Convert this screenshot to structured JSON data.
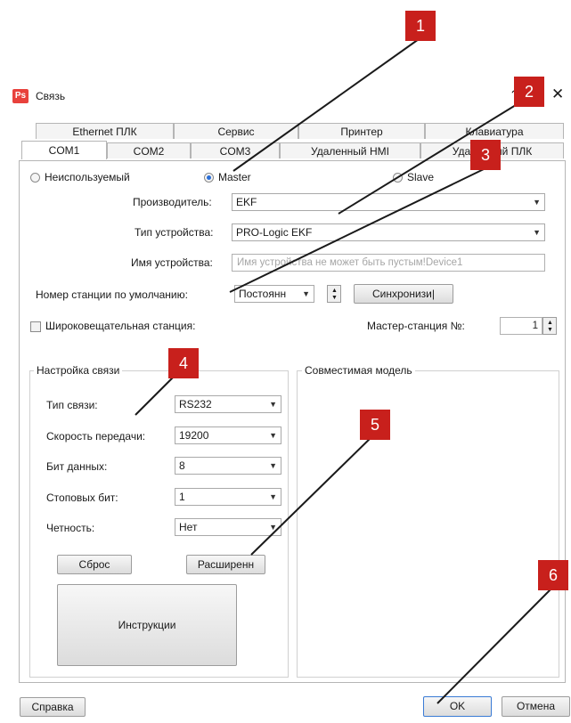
{
  "window": {
    "title": "Связь",
    "app_icon": "Ps",
    "help": "?",
    "close": "✕"
  },
  "tabs_row1": [
    "Ethernet ПЛК",
    "Сервис",
    "Принтер",
    "Клавиатура"
  ],
  "tabs_row2": [
    "COM1",
    "COM2",
    "COM3",
    "Удаленный HMI",
    "Удаленный ПЛК"
  ],
  "mode": {
    "unused": "Неиспользуемый",
    "master": "Master",
    "slave": "Slave"
  },
  "form": {
    "manufacturer_label": "Производитель:",
    "manufacturer_value": "EKF",
    "device_type_label": "Тип устройства:",
    "device_type_value": "PRO-Logic EKF",
    "device_name_label": "Имя устройства:",
    "device_name_placeholder": "Имя устройства не может быть пустым!Device1",
    "station_label": "Номер станции по умолчанию:",
    "station_value": "Постоянн",
    "sync_button": "Синхронизи|",
    "broadcast_label": "Широковещательная станция:",
    "master_station_label": "Мастер-станция №:",
    "master_station_value": "1"
  },
  "comm": {
    "group_title": "Настройка связи",
    "type_label": "Тип связи:",
    "type_value": "RS232",
    "baud_label": "Скорость передачи:",
    "baud_value": "19200",
    "data_bits_label": "Бит данных:",
    "data_bits_value": "8",
    "stop_bits_label": "Стоповых бит:",
    "stop_bits_value": "1",
    "parity_label": "Четность:",
    "parity_value": "Нет",
    "reset_button": "Сброс",
    "advanced_button": "Расширенн",
    "instructions_button": "Инструкции"
  },
  "compat": {
    "group_title": "Совместимая модель"
  },
  "footer": {
    "help_button": "Справка",
    "ok_button": "OK",
    "cancel_button": "Отмена"
  },
  "callouts": [
    "1",
    "2",
    "3",
    "4",
    "5",
    "6"
  ],
  "colors": {
    "callout": "#c8201c",
    "arrow": "#1a1a1a",
    "radio_selected": "#2a6ed6"
  }
}
